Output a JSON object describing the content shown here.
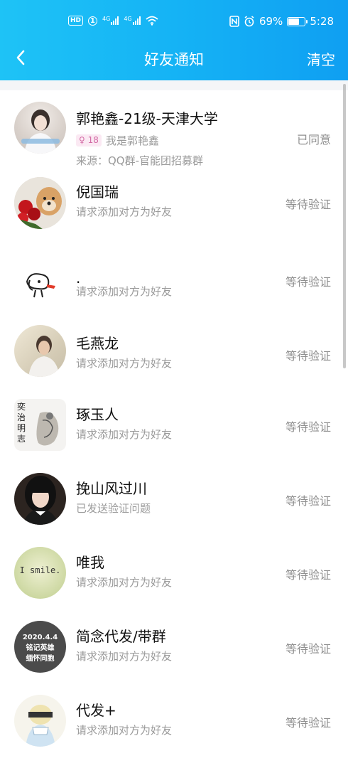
{
  "status_bar": {
    "left_badges": [
      "HD",
      "1",
      "4G",
      "4G"
    ],
    "battery": "69%",
    "battery_level": 0.69,
    "time": "5:28"
  },
  "nav": {
    "back_icon": "chevron-left-icon",
    "title": "好友通知",
    "clear_label": "清空"
  },
  "requests": [
    {
      "name": "郭艳鑫-21级-天津大学",
      "age": "18",
      "message": "我是郭艳鑫",
      "source": "来源：QQ群-官能团招募群",
      "status": "已同意"
    },
    {
      "name": "倪国瑞",
      "message": "请求添加对方为好友",
      "status": "等待验证"
    },
    {
      "name": ".",
      "message": "请求添加对方为好友",
      "status": "等待验证"
    },
    {
      "name": "毛燕龙",
      "message": "请求添加对方为好友",
      "status": "等待验证"
    },
    {
      "name": "琢玉人",
      "message": "请求添加对方为好友",
      "status": "等待验证",
      "avatar_text": [
        "奕",
        "治",
        "明",
        "志"
      ]
    },
    {
      "name": "挽山风过川",
      "message": "已发送验证问题",
      "status": "等待验证"
    },
    {
      "name": "唯我",
      "message": "请求添加对方为好友",
      "status": "等待验证",
      "avatar_text": [
        "I smile."
      ]
    },
    {
      "name": "简念代发/带群",
      "message": "请求添加对方为好友",
      "status": "等待验证",
      "avatar_text": [
        "2020.4.4",
        "铭记英雄",
        "缅怀同胞"
      ]
    },
    {
      "name": "代发+",
      "message": "请求添加对方为好友",
      "status": "等待验证"
    }
  ]
}
